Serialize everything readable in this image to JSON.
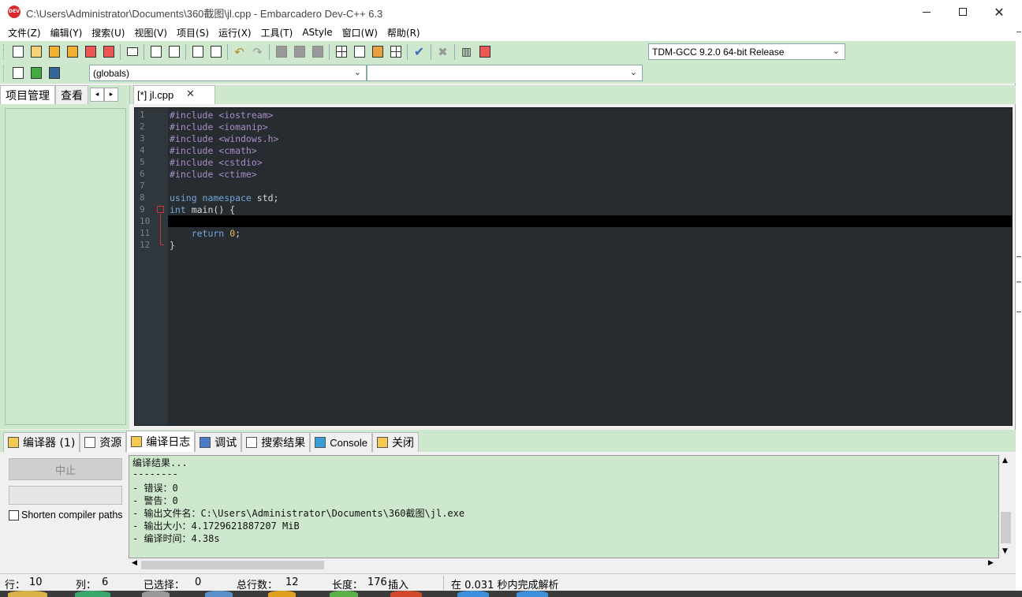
{
  "window": {
    "title": "C:\\Users\\Administrator\\Documents\\360截图\\jl.cpp - Embarcadero Dev-C++ 6.3",
    "app_icon_text": "DEV"
  },
  "menu": [
    "文件(Z)",
    "编辑(Y)",
    "搜索(U)",
    "视图(V)",
    "项目(S)",
    "运行(X)",
    "工具(T)",
    "AStyle",
    "窗口(W)",
    "帮助(R)"
  ],
  "toolbar": {
    "compiler_select": "TDM-GCC 9.2.0 64-bit Release",
    "scope_select": "(globals)",
    "function_select": ""
  },
  "left_panel": {
    "tabs": [
      "项目管理",
      "查看"
    ],
    "scroll_left": "◂",
    "scroll_right": "▸"
  },
  "editor": {
    "tab_label": "[*] jl.cpp",
    "tab_close": "✕",
    "current_line": 10,
    "lines": [
      {
        "n": "1",
        "parts": [
          {
            "t": "#include <iostream>",
            "c": "pp"
          }
        ]
      },
      {
        "n": "2",
        "parts": [
          {
            "t": "#include <iomanip>",
            "c": "pp"
          }
        ]
      },
      {
        "n": "3",
        "parts": [
          {
            "t": "#include <windows.h>",
            "c": "pp"
          }
        ]
      },
      {
        "n": "4",
        "parts": [
          {
            "t": "#include <cmath>",
            "c": "pp"
          }
        ]
      },
      {
        "n": "5",
        "parts": [
          {
            "t": "#include <cstdio>",
            "c": "pp"
          }
        ]
      },
      {
        "n": "6",
        "parts": [
          {
            "t": "#include <ctime>",
            "c": "pp"
          }
        ]
      },
      {
        "n": "7",
        "parts": []
      },
      {
        "n": "8",
        "parts": [
          {
            "t": "using namespace",
            "c": "kw"
          },
          {
            "t": " std;",
            "c": "id"
          }
        ]
      },
      {
        "n": "9",
        "parts": [
          {
            "t": "int",
            "c": "kw"
          },
          {
            "t": " main() {",
            "c": "id"
          }
        ]
      },
      {
        "n": "10",
        "parts": []
      },
      {
        "n": "11",
        "parts": [
          {
            "t": "    return",
            "c": "kw"
          },
          {
            "t": " ",
            "c": "id"
          },
          {
            "t": "0",
            "c": "num"
          },
          {
            "t": ";",
            "c": "id"
          }
        ]
      },
      {
        "n": "12",
        "parts": [
          {
            "t": "}",
            "c": "id"
          }
        ]
      }
    ]
  },
  "bottom_tabs": [
    {
      "label": "编译器 (1)",
      "icon": "compiler-icon"
    },
    {
      "label": "资源",
      "icon": "resource-icon"
    },
    {
      "label": "编译日志",
      "icon": "compile-log-icon"
    },
    {
      "label": "调试",
      "icon": "debug-icon"
    },
    {
      "label": "搜索结果",
      "icon": "search-results-icon"
    },
    {
      "label": "Console",
      "icon": "console-icon"
    },
    {
      "label": "关闭",
      "icon": "close-panel-icon"
    }
  ],
  "bottom_panel": {
    "stop_button": "中止",
    "shorten_paths_label": "Shorten compiler paths",
    "log_lines": [
      "编译结果...",
      "--------",
      "- 错误：0",
      "- 警告：0",
      "- 输出文件名：C:\\Users\\Administrator\\Documents\\360截图\\jl.exe",
      "- 输出大小：4.1729621887207 MiB",
      "- 编译时间：4.38s"
    ]
  },
  "status": {
    "row_label": "行：",
    "row_value": "10",
    "col_label": "列：",
    "col_value": "6",
    "sel_label": "已选择：",
    "sel_value": "0",
    "total_label": "总行数：",
    "total_value": "12",
    "len_label": "长度：",
    "len_value": "176",
    "mode": "插入",
    "parse_msg": "在 0.031 秒内完成解析"
  }
}
